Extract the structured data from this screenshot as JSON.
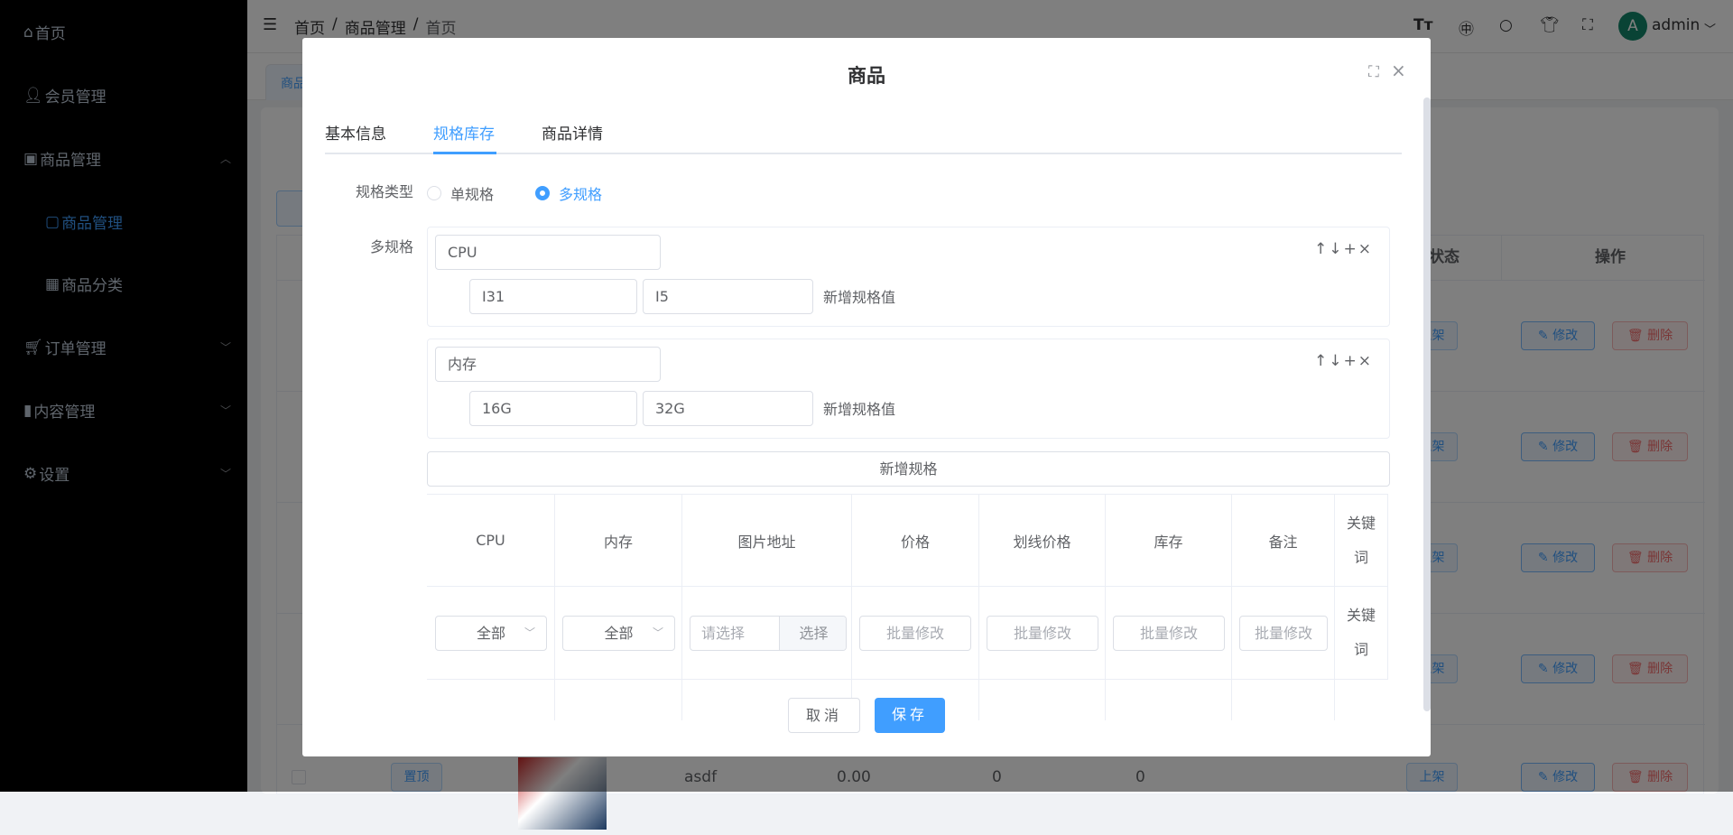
{
  "sidebar": {
    "items": [
      {
        "label": "首页",
        "icon": "home-icon"
      },
      {
        "label": "会员管理",
        "icon": "user-icon"
      },
      {
        "label": "商品管理",
        "icon": "bag-icon",
        "expanded": true
      },
      {
        "label": "商品管理",
        "icon": "bag-icon",
        "sub": true,
        "active": true
      },
      {
        "label": "商品分类",
        "icon": "grid-icon",
        "sub": true
      },
      {
        "label": "订单管理",
        "icon": "cart-icon"
      },
      {
        "label": "内容管理",
        "icon": "book-icon"
      },
      {
        "label": "设置",
        "icon": "gear-icon"
      }
    ]
  },
  "header": {
    "breadcrumb": [
      "首页",
      "商品管理",
      "首页"
    ],
    "sep": "/",
    "user": "admin",
    "avatar_letter": "A",
    "avatar_color": "#13876a"
  },
  "tabs": {
    "active": "商品"
  },
  "bg_table": {
    "headers": {
      "status": "状态",
      "ops": "操作"
    },
    "status_label": "上架",
    "edit_label": "修改",
    "delete_label": "删除",
    "last_row": {
      "top_label": "置顶",
      "name": "asdf",
      "price": "0.00",
      "v1": "0",
      "v2": "0",
      "status": "上架"
    }
  },
  "modal": {
    "title": "商品",
    "tabs": [
      "基本信息",
      "规格库存",
      "商品详情"
    ],
    "active_tab": 1,
    "spec_type_label": "规格类型",
    "spec_type_options": [
      "单规格",
      "多规格"
    ],
    "spec_type_selected": 1,
    "multi_label": "多规格",
    "specs": [
      {
        "name": "CPU",
        "values": [
          "I31",
          "I5"
        ]
      },
      {
        "name": "内存",
        "values": [
          "16G",
          "32G"
        ]
      }
    ],
    "add_value_label": "新增规格值",
    "add_spec_label": "新增规格",
    "spec_ops": "↑↓+×",
    "table": {
      "headers": [
        "CPU",
        "内存",
        "图片地址",
        "价格",
        "划线价格",
        "库存",
        "备注",
        "关键词"
      ],
      "batch": {
        "cpu": "全部",
        "mem": "全部",
        "image_placeholder": "请选择",
        "image_button": "选择",
        "price_placeholder": "批量修改",
        "orig_placeholder": "批量修改",
        "stock_placeholder": "批量修改",
        "note_placeholder": "批量修改",
        "keyword": "关键词"
      }
    },
    "cancel": "取消",
    "save": "保存"
  },
  "colors": {
    "primary": "#409eff",
    "danger": "#f56c6c"
  }
}
